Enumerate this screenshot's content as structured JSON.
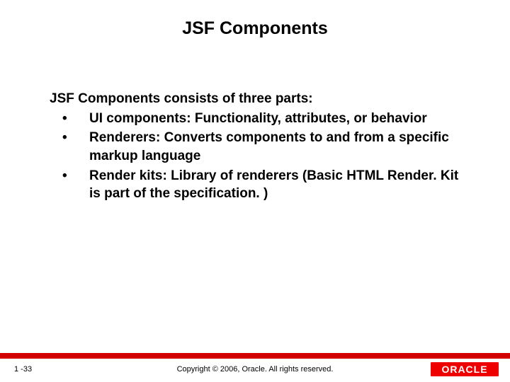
{
  "title": "JSF Components",
  "intro": "JSF Components consists of three parts:",
  "bullets": [
    "UI components: Functionality, attributes, or behavior",
    "Renderers: Converts components to and from a specific markup language",
    "Render kits: Library of renderers (Basic HTML Render. Kit is part of the specification. )"
  ],
  "footer": {
    "page": "1 -33",
    "copyright": "Copyright © 2006, Oracle.  All rights reserved.",
    "logo_text": "ORACLE"
  }
}
